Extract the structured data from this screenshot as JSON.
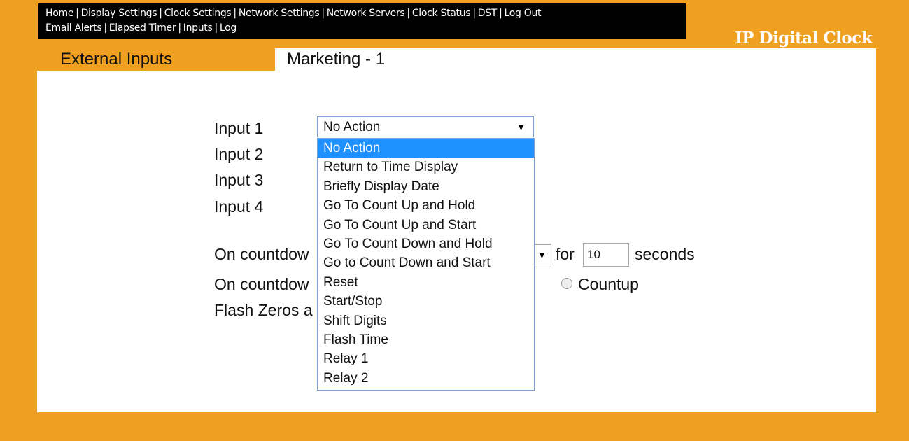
{
  "nav": {
    "row1": [
      "Home",
      "Display Settings",
      "Clock Settings",
      "Network Settings",
      "Network Servers",
      "Clock Status",
      "DST",
      "Log Out"
    ],
    "row2": [
      "Email Alerts",
      "Elapsed Timer",
      "Inputs",
      "Log"
    ],
    "separator": "|"
  },
  "brand": "IP Digital Clock",
  "section_title": "External Inputs",
  "device_name": "Marketing - 1",
  "form": {
    "inputs": [
      {
        "label": "Input 1",
        "value": "No Action"
      },
      {
        "label": "Input 2"
      },
      {
        "label": "Input 3"
      },
      {
        "label": "Input 4"
      }
    ],
    "countdown_row1_prefix": "On countdow",
    "for_label": "for",
    "seconds_value": "10",
    "seconds_label": "seconds",
    "countdown_row2_prefix": "On countdow",
    "countup_label": "Countup",
    "flash_zeros_prefix": "Flash Zeros a"
  },
  "dropdown": {
    "options": [
      "No Action",
      "Return to Time Display",
      "Briefly Display Date",
      "Go To Count Up and Hold",
      "Go To Count Up and Start",
      "Go To Count Down and Hold",
      "Go to Count Down and Start",
      "Reset",
      "Start/Stop",
      "Shift Digits",
      "Flash Time",
      "Relay 1",
      "Relay 2"
    ],
    "selected": "No Action"
  },
  "icons": {
    "arrow": "▼"
  },
  "colors": {
    "background": "#f0a020",
    "highlight": "#1e90ff",
    "nav_bar": "#000000"
  }
}
